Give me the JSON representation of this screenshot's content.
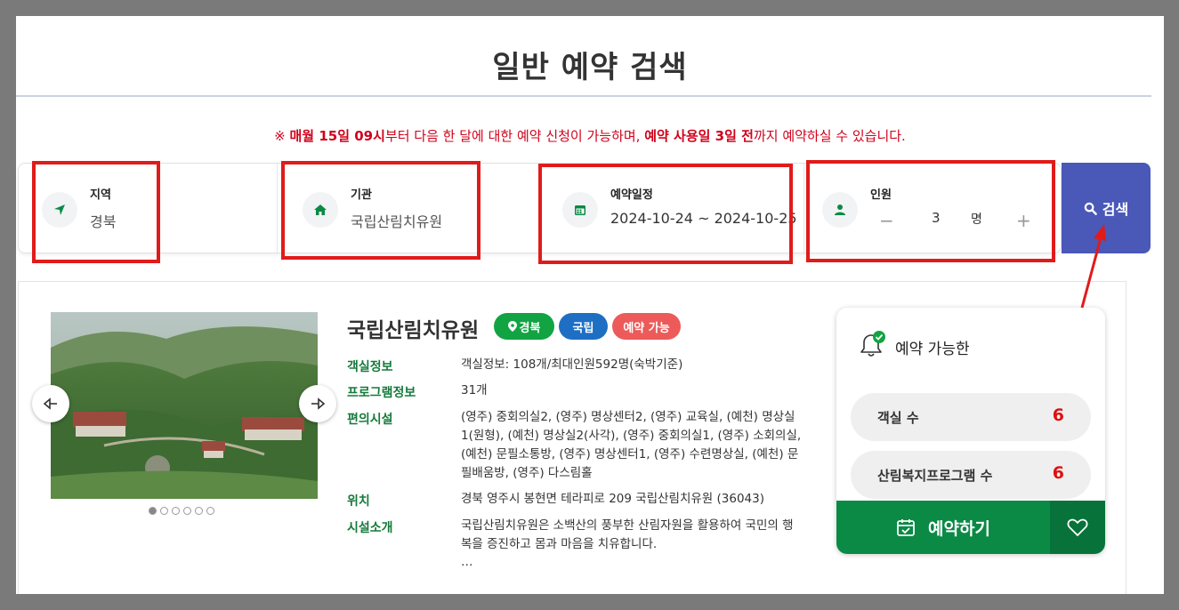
{
  "page": {
    "title": "일반 예약 검색"
  },
  "notice": {
    "prefix": "※ ",
    "part1": "매월 15일 09시",
    "part2": "부터 다음 한 달에 대한 예약 신청이 가능하며, ",
    "part3": "예약 사용일 3일 전",
    "part4": "까지 예약하실 수 있습니다."
  },
  "search": {
    "region": {
      "label": "지역",
      "value": "경북",
      "icon": "location-arrow-icon"
    },
    "institution": {
      "label": "기관",
      "value": "국립산림치유원",
      "icon": "home-icon"
    },
    "schedule": {
      "label": "예약일정",
      "value": "2024-10-24 ~ 2024-10-25",
      "icon": "calendar-icon"
    },
    "people": {
      "label": "인원",
      "minus": "−",
      "count": "3",
      "unit": "명",
      "plus": "+",
      "icon": "user-icon"
    },
    "button_label": "검색"
  },
  "facility": {
    "name": "국립산림치유원",
    "tags": [
      {
        "label": "경북",
        "color": "#12a343"
      },
      {
        "label": "국립",
        "color": "#1e6fc4"
      },
      {
        "label": "예약 가능",
        "color": "#ec5a5a"
      }
    ],
    "info": [
      {
        "label": "객실정보",
        "value": "객실정보: 108개/최대인원592명(숙박기준)"
      },
      {
        "label": "프로그램정보",
        "value": "31개"
      },
      {
        "label": "편의시설",
        "value": "(영주) 중회의실2, (영주) 명상센터2, (영주) 교육실, (예천) 명상실1(원형), (예천) 명상실2(사각), (영주) 중회의실1, (영주) 소회의실, (예천) 문필소통방, (영주) 명상센터1, (영주) 수련명상실, (예천) 문필배움방, (영주) 다스림홀"
      },
      {
        "label": "위치",
        "value": "경북 영주시 봉현면 테라피로 209 국립산림치유원 (36043)"
      },
      {
        "label": "시설소개",
        "value": "국립산림치유원은 소백산의 풍부한 산림자원을 활용하여 국민의 행복을 증진하고 몸과 마음을 치유합니다."
      }
    ],
    "ellipsis": "…",
    "photo_dots": 6,
    "photo_active": 0
  },
  "availability": {
    "title": "예약 가능한",
    "stats": [
      {
        "label": "객실 수",
        "value": "6"
      },
      {
        "label": "산림복지프로그램 수",
        "value": "6"
      }
    ],
    "reserve_label": "예약하기"
  },
  "colors": {
    "accent_green": "#0a8a45",
    "label_green": "#157a3a",
    "search_blue": "#4a58b8",
    "notice_red": "#d0021b",
    "annotation_red": "#e01b1b"
  }
}
